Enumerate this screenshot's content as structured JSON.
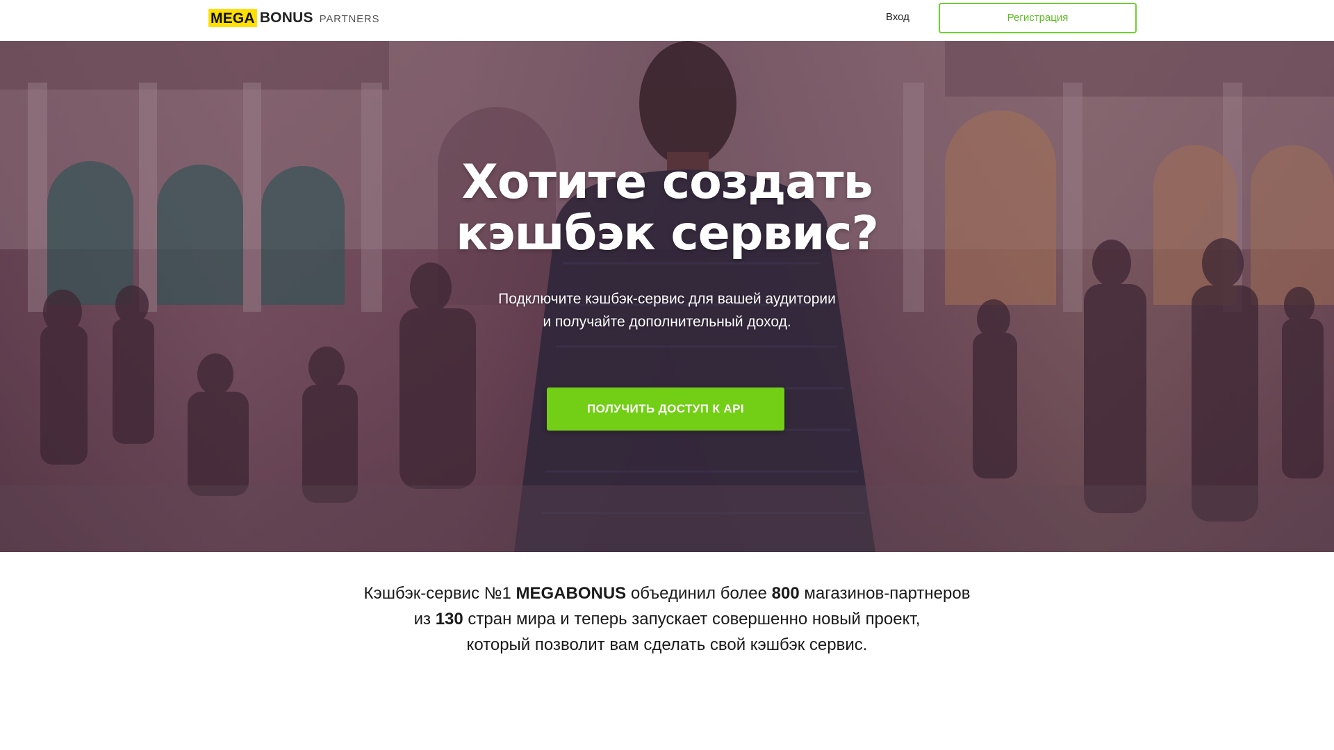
{
  "header": {
    "logo": {
      "mega": "MEGA",
      "bonus": "BONUS",
      "partners": "PARTNERS"
    },
    "login_label": "Вход",
    "register_label": "Регистрация"
  },
  "hero": {
    "title_line1": "Хотите создать",
    "title_line2": "кэшбэк сервис?",
    "subtitle_line1": "Подключите кэшбэк-сервис для вашей аудитории",
    "subtitle_line2": "и получайте дополнительный доход.",
    "cta_label": "ПОЛУЧИТЬ ДОСТУП К API"
  },
  "intro": {
    "line1_a": "Кэшбэк-сервис №1 ",
    "line1_brand": "MEGABONUS",
    "line1_b": " объединил более ",
    "line1_num": "800",
    "line1_c": " магазинов-партнеров",
    "line2_a": "из ",
    "line2_num": "130",
    "line2_b": " стран мира и теперь запускает совершенно новый проект,",
    "line3": "который позволит вам сделать свой кэшбэк сервис."
  },
  "colors": {
    "accent_green": "#72cf16",
    "register_border": "#6fd02f",
    "logo_yellow": "#ffe000"
  },
  "icons": {
    "hero_background": "crowd-street-photo"
  }
}
